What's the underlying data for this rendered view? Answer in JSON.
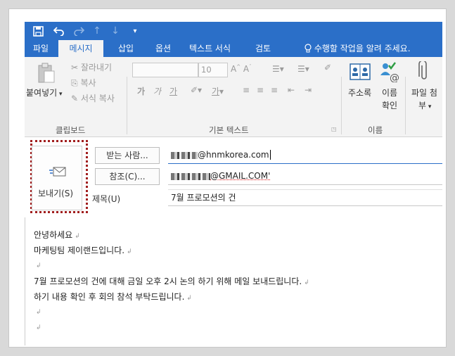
{
  "tabs": [
    {
      "label": "파일",
      "active": false
    },
    {
      "label": "메시지",
      "active": true
    },
    {
      "label": "삽입",
      "active": false
    },
    {
      "label": "옵션",
      "active": false
    },
    {
      "label": "텍스트 서식",
      "active": false
    },
    {
      "label": "검토",
      "active": false
    }
  ],
  "tell_me": "수행할 작업을 알려 주세요.",
  "ribbon": {
    "clipboard": {
      "paste": "붙여넣기",
      "cut": "잘라내기",
      "copy": "복사",
      "format_painter": "서식 복사",
      "group_label": "클립보드"
    },
    "basic_text": {
      "font_size": "10",
      "group_label": "기본 텍스트"
    },
    "names": {
      "address_book": "주소록",
      "check_names_line1": "이름",
      "check_names_line2": "확인",
      "group_label": "이름"
    },
    "include": {
      "attach_file_line1": "파일 첨",
      "attach_file_line2": "부"
    }
  },
  "compose": {
    "send_label": "보내기(S)",
    "to_button": "받는 사람...",
    "cc_button": "참조(C)...",
    "subject_label": "제목(U)",
    "to_value": "@hnmkorea.com",
    "cc_value": "@GMAIL.COM'",
    "subject_value": "7월 프로모션의 건"
  },
  "body_lines": [
    "안녕하세요",
    "마케팅팀 제이랜드입니다.",
    "",
    "7월 프로모션의 건에 대해 금일 오후 2시 논의 하기 위해 메일 보내드립니다.",
    "하기 내용 확인 후 회의 참석 부탁드립니다.",
    "",
    ""
  ],
  "colors": {
    "accent": "#2b6fc8",
    "highlight_border": "#a11e1e"
  },
  "icons": [
    "save-icon",
    "undo-icon",
    "redo-icon",
    "up-arrow-icon",
    "down-arrow-icon",
    "customize-icon",
    "lightbulb-icon",
    "paste-icon",
    "cut-icon",
    "copy-icon",
    "format-painter-icon",
    "address-book-icon",
    "check-names-icon",
    "attach-file-icon",
    "send-icon"
  ]
}
